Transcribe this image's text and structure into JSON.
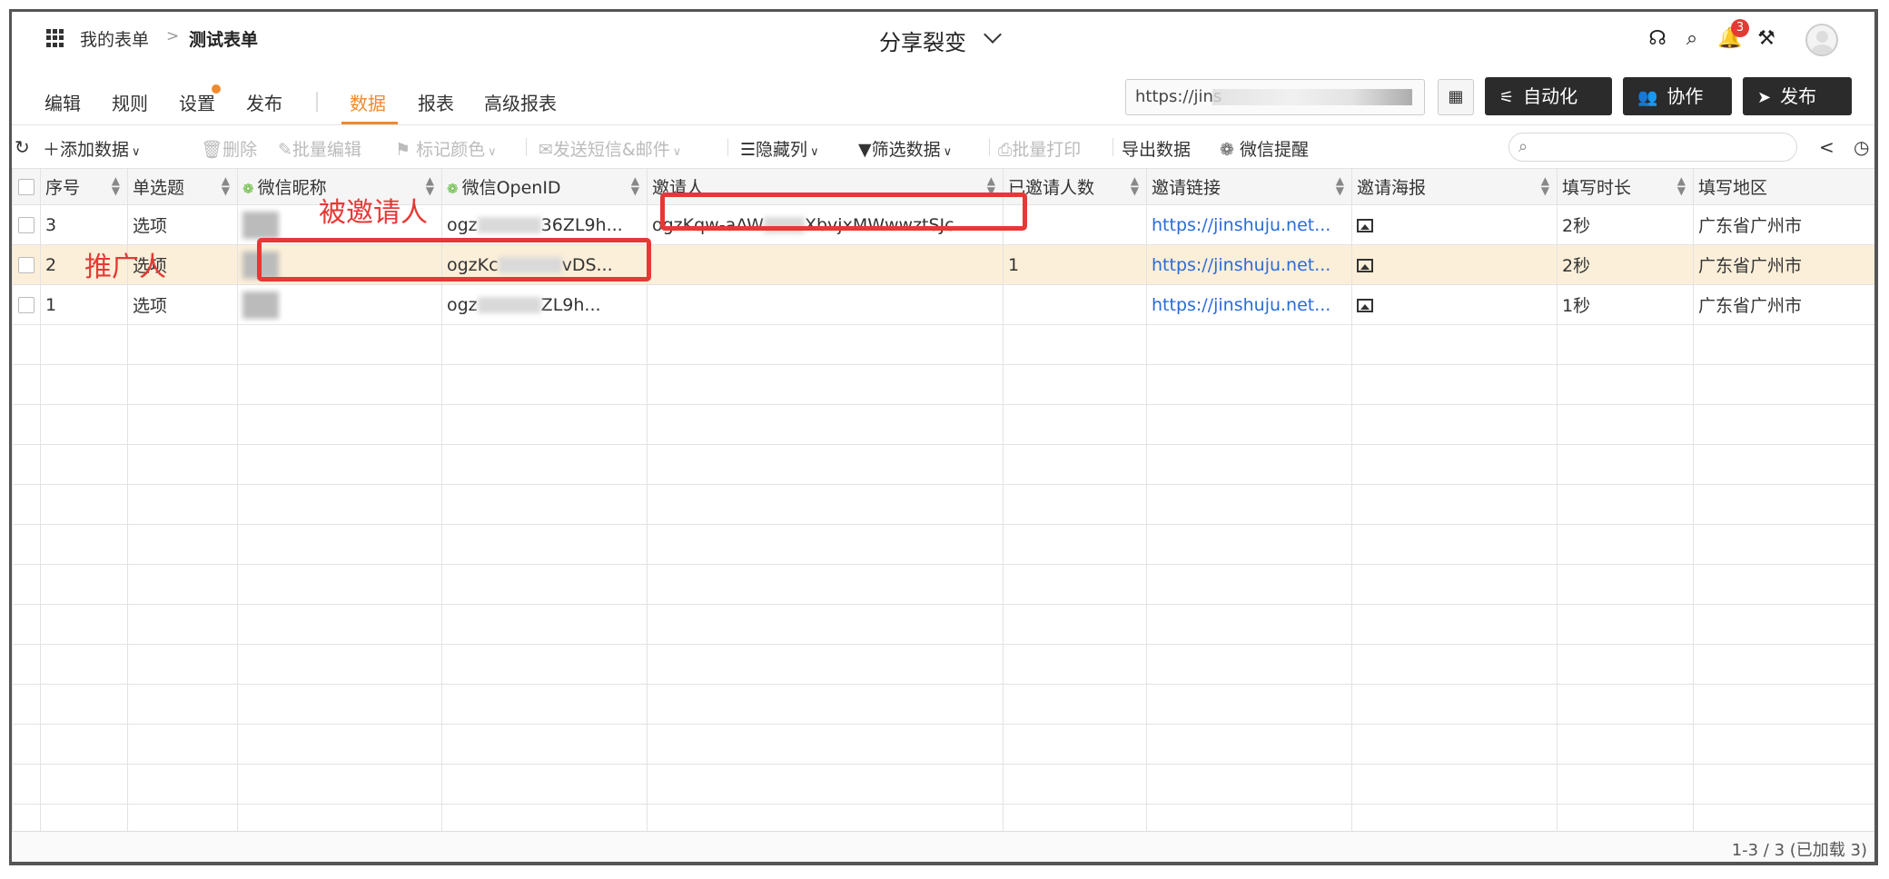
{
  "header": {
    "breadcrumb_root": "我的表单",
    "breadcrumb_sep": ">",
    "breadcrumb_current": "测试表单",
    "form_title": "分享裂变",
    "notification_count": "3"
  },
  "nav": {
    "edit": "编辑",
    "rules": "规则",
    "settings": "设置",
    "publish": "发布",
    "data": "数据",
    "reports": "报表",
    "advanced_reports": "高级报表",
    "active_tab": "数据"
  },
  "share": {
    "url": "https://jins",
    "automation_label": "自动化",
    "collaborate_label": "协作",
    "publish_label": "发布"
  },
  "toolbar": {
    "add_data": "添加数据",
    "delete": "删除",
    "bulk_edit": "批量编辑",
    "mark_color": "标记颜色",
    "send_sms_email": "发送短信&邮件",
    "hide_columns": "隐藏列",
    "filter_data": "筛选数据",
    "bulk_print": "批量打印",
    "export_data": "导出数据",
    "wechat_remind": "微信提醒"
  },
  "table": {
    "columns": [
      "序号",
      "单选题",
      "微信昵称",
      "微信OpenID",
      "邀请人",
      "已邀请人数",
      "邀请链接",
      "邀请海报",
      "填写时长",
      "填写地区"
    ],
    "rows": [
      {
        "seq": "3",
        "choice": "选项",
        "openid": "ogz",
        "openid_tail": "36ZL9h...",
        "inviter": "ogzKqw-aAW",
        "inviter_tail": "XbvjxMWwwztSJc",
        "invited_count": "",
        "link": "https://jinshuju.net...",
        "duration": "2秒",
        "region": "广东省广州市"
      },
      {
        "seq": "2",
        "choice": "选项",
        "openid": "ogzKc",
        "openid_tail": "vDS...",
        "inviter": "",
        "inviter_tail": "",
        "invited_count": "1",
        "link": "https://jinshuju.net...",
        "duration": "2秒",
        "region": "广东省广州市"
      },
      {
        "seq": "1",
        "choice": "选项",
        "openid": "ogz",
        "openid_tail": "ZL9h...",
        "inviter": "",
        "inviter_tail": "",
        "invited_count": "",
        "link": "https://jinshuju.net...",
        "duration": "1秒",
        "region": "广东省广州市"
      }
    ],
    "highlighted_row": "2"
  },
  "annotations": {
    "invitee": "被邀请人",
    "promoter": "推广人"
  },
  "footer": {
    "row_count": "1-3 / 3 (已加载 3)"
  },
  "colors": {
    "accent": "#f08a2c",
    "annotation": "#e53935",
    "link": "#2a6bd9",
    "highlight_row": "#fcefd9",
    "dark_button": "#2b2b2b"
  },
  "icons": [
    "apps-grid-icon",
    "help-icon",
    "search-icon",
    "bell-icon",
    "tools-icon",
    "qr-code-icon",
    "automation-icon",
    "collaborate-icon",
    "send-icon",
    "refresh-icon",
    "plus-icon",
    "trash-icon",
    "pencil-icon",
    "flag-icon",
    "mail-icon",
    "list-icon",
    "filter-icon",
    "print-icon",
    "wechat-icon",
    "share-icon",
    "history-icon",
    "image-icon",
    "sort-icon"
  ]
}
